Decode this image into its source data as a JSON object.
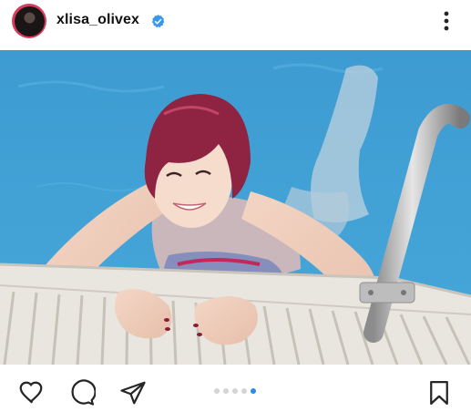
{
  "post": {
    "username": "xlisa_olivex",
    "verified": true,
    "carousel": {
      "total": 5,
      "current": 5
    }
  },
  "colors": {
    "accent": "#2a8ce8",
    "verified_badge": "#3897f0",
    "story_ring": "#d93b5e",
    "icon": "#262626"
  },
  "icons": {
    "more": "more-options-icon",
    "like": "heart-icon",
    "comment": "comment-icon",
    "share": "send-icon",
    "save": "bookmark-icon"
  }
}
